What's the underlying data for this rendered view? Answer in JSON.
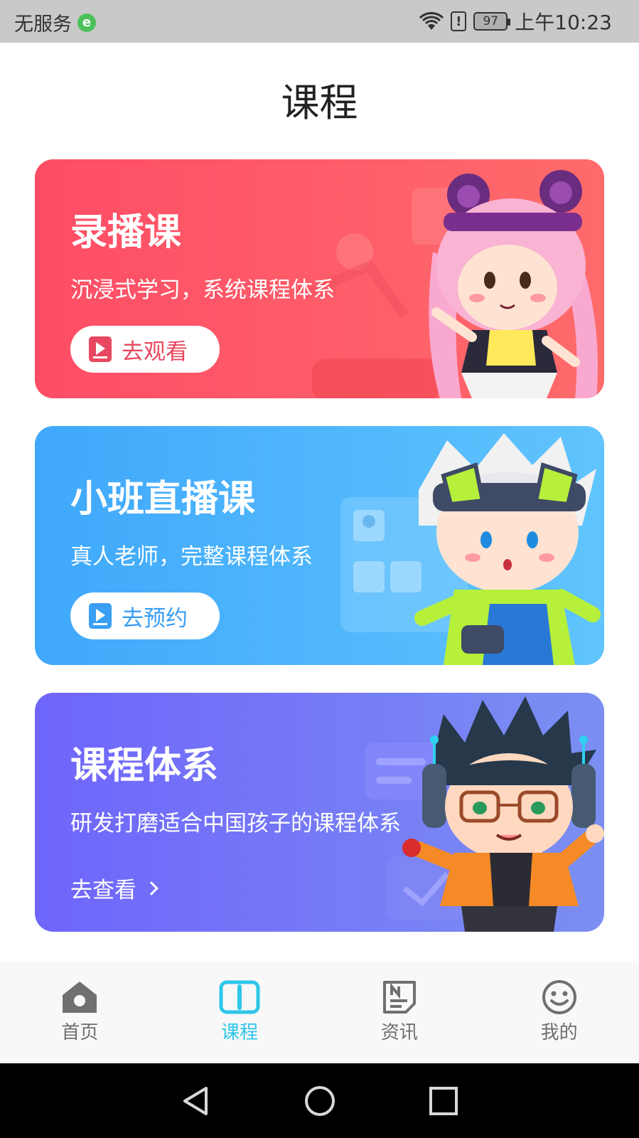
{
  "status_bar": {
    "carrier": "无服务",
    "carrier_badge": "e",
    "battery": "97",
    "alert_glyph": "!",
    "time": "上午10:23"
  },
  "page": {
    "title": "课程"
  },
  "cards": [
    {
      "title": "录播课",
      "subtitle": "沉浸式学习，系统课程体系",
      "action_label": "去观看",
      "action_icon": "video-play-icon",
      "color_start": "#fe4d66",
      "color_end": "#fe6b6b"
    },
    {
      "title": "小班直播课",
      "subtitle": "真人老师，完整课程体系",
      "action_label": "去预约",
      "action_icon": "video-play-icon",
      "color_start": "#3fa8fb",
      "color_end": "#60c4fd"
    },
    {
      "title": "课程体系",
      "subtitle": "研发打磨适合中国孩子的课程体系",
      "action_label": "去查看",
      "action_icon": "chevron-right-icon",
      "color_start": "#6f65fb",
      "color_end": "#7b8ff2"
    }
  ],
  "bottom_nav": {
    "items": [
      {
        "label": "首页",
        "icon": "home-icon",
        "active": false
      },
      {
        "label": "课程",
        "icon": "book-icon",
        "active": true
      },
      {
        "label": "资讯",
        "icon": "news-icon",
        "active": false
      },
      {
        "label": "我的",
        "icon": "smiley-icon",
        "active": false
      }
    ],
    "active_color": "#2ec6e9",
    "inactive_color": "#6e6e6e"
  },
  "system_nav": {
    "items": [
      {
        "icon": "back-triangle-icon"
      },
      {
        "icon": "home-circle-icon"
      },
      {
        "icon": "recents-square-icon"
      }
    ]
  }
}
